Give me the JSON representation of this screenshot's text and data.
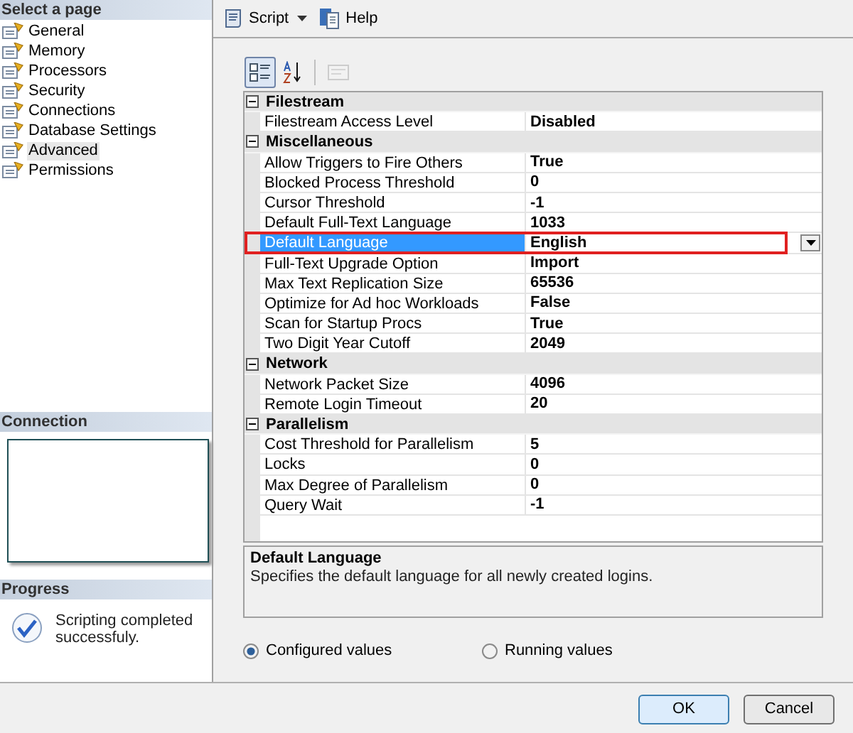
{
  "sidebar": {
    "header": "Select a page",
    "items": [
      {
        "label": "General",
        "selected": false
      },
      {
        "label": "Memory",
        "selected": false
      },
      {
        "label": "Processors",
        "selected": false
      },
      {
        "label": "Security",
        "selected": false
      },
      {
        "label": "Connections",
        "selected": false
      },
      {
        "label": "Database Settings",
        "selected": false
      },
      {
        "label": "Advanced",
        "selected": true
      },
      {
        "label": "Permissions",
        "selected": false
      }
    ]
  },
  "connection": {
    "header": "Connection"
  },
  "progress": {
    "header": "Progress",
    "message": "Scripting completed successfuly."
  },
  "toolbar": [
    {
      "kind": "script",
      "label": "Script"
    },
    {
      "kind": "help",
      "label": "Help"
    }
  ],
  "grid_toolbar": [
    {
      "kind": "categorized",
      "selected": true,
      "disabled": false
    },
    {
      "kind": "alphabetical",
      "selected": false,
      "disabled": false
    },
    {
      "kind": "property_pages",
      "selected": false,
      "disabled": true
    }
  ],
  "categories": [
    {
      "name": "Filestream",
      "expanded": true,
      "rows": [
        {
          "name": "Filestream Access Level",
          "value": "Disabled",
          "selected": false,
          "highlighted": false
        }
      ]
    },
    {
      "name": "Miscellaneous",
      "expanded": true,
      "rows": [
        {
          "name": "Allow Triggers to Fire Others",
          "value": "True",
          "selected": false,
          "highlighted": false
        },
        {
          "name": "Blocked Process Threshold",
          "value": "0",
          "selected": false,
          "highlighted": false
        },
        {
          "name": "Cursor Threshold",
          "value": "-1",
          "selected": false,
          "highlighted": false
        },
        {
          "name": "Default Full-Text Language",
          "value": "1033",
          "selected": false,
          "highlighted": false
        },
        {
          "name": "Default Language",
          "value": "English",
          "selected": true,
          "highlighted": true
        },
        {
          "name": "Full-Text Upgrade Option",
          "value": "Import",
          "selected": false,
          "highlighted": false
        },
        {
          "name": "Max Text Replication Size",
          "value": "65536",
          "selected": false,
          "highlighted": false
        },
        {
          "name": "Optimize for Ad hoc Workloads",
          "value": "False",
          "selected": false,
          "highlighted": false
        },
        {
          "name": "Scan for Startup Procs",
          "value": "True",
          "selected": false,
          "highlighted": false
        },
        {
          "name": "Two Digit Year Cutoff",
          "value": "2049",
          "selected": false,
          "highlighted": false
        }
      ]
    },
    {
      "name": "Network",
      "expanded": true,
      "rows": [
        {
          "name": "Network Packet Size",
          "value": "4096",
          "selected": false,
          "highlighted": false
        },
        {
          "name": "Remote Login Timeout",
          "value": "20",
          "selected": false,
          "highlighted": false
        }
      ]
    },
    {
      "name": "Parallelism",
      "expanded": true,
      "rows": [
        {
          "name": "Cost Threshold for Parallelism",
          "value": "5",
          "selected": false,
          "highlighted": false
        },
        {
          "name": "Locks",
          "value": "0",
          "selected": false,
          "highlighted": false
        },
        {
          "name": "Max Degree of Parallelism",
          "value": "0",
          "selected": false,
          "highlighted": false
        },
        {
          "name": "Query Wait",
          "value": "-1",
          "selected": false,
          "highlighted": false
        }
      ]
    }
  ],
  "description": {
    "title": "Default Language",
    "text": "Specifies the default language for all newly created logins."
  },
  "radios": [
    {
      "label": "Configured values",
      "selected": true
    },
    {
      "label": "Running values",
      "selected": false
    }
  ],
  "buttons": [
    {
      "label": "OK",
      "default": true
    },
    {
      "label": "Cancel",
      "default": false
    }
  ]
}
